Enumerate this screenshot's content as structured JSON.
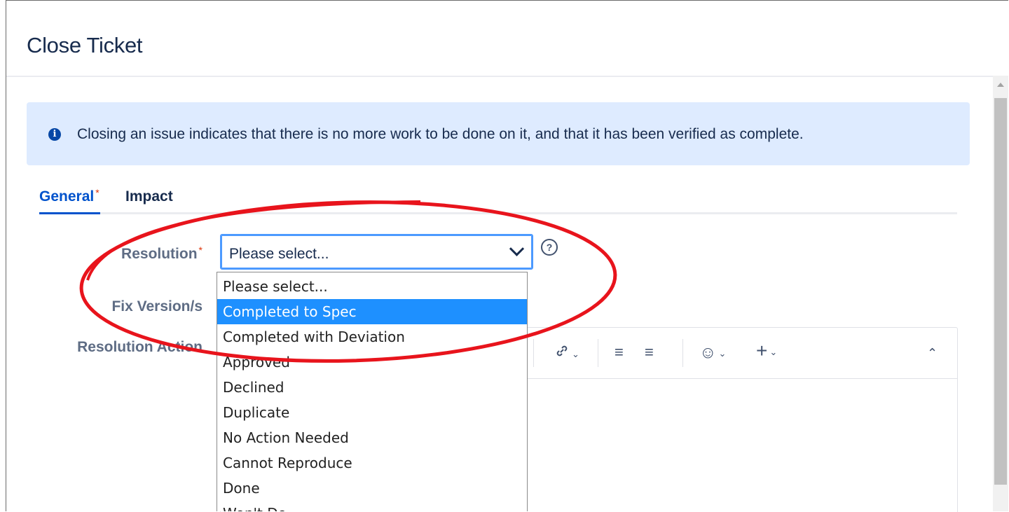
{
  "dialog": {
    "title": "Close Ticket"
  },
  "info_banner": {
    "icon": "info-icon",
    "text": "Closing an issue indicates that there is no more work to be done on it, and that it has been verified as complete."
  },
  "tabs": [
    {
      "label": "General",
      "required_marker": "*",
      "active": true
    },
    {
      "label": "Impact",
      "active": false
    }
  ],
  "form": {
    "resolution": {
      "label": "Resolution",
      "required_marker": "*",
      "selected": "Please select...",
      "help_icon": "?",
      "options": [
        "Please select...",
        "Completed to Spec",
        "Completed with Deviation",
        "Approved",
        "Declined",
        "Duplicate",
        "No Action Needed",
        "Cannot Reproduce",
        "Done",
        "Won't Do"
      ],
      "highlighted_option": "Completed to Spec"
    },
    "fix_version": {
      "label": "Fix Version/s"
    },
    "resolution_action": {
      "label": "Resolution Action"
    }
  },
  "editor_toolbar": {
    "icons": [
      "link-icon",
      "bullet-list-icon",
      "numbered-list-icon",
      "emoji-icon",
      "insert-plus-icon",
      "collapse-toolbar-icon"
    ]
  },
  "colors": {
    "primary": "#0052cc",
    "banner_bg": "#deebff",
    "option_highlight": "#1e90ff",
    "annotation": "#e8141c",
    "required": "#de350b"
  }
}
